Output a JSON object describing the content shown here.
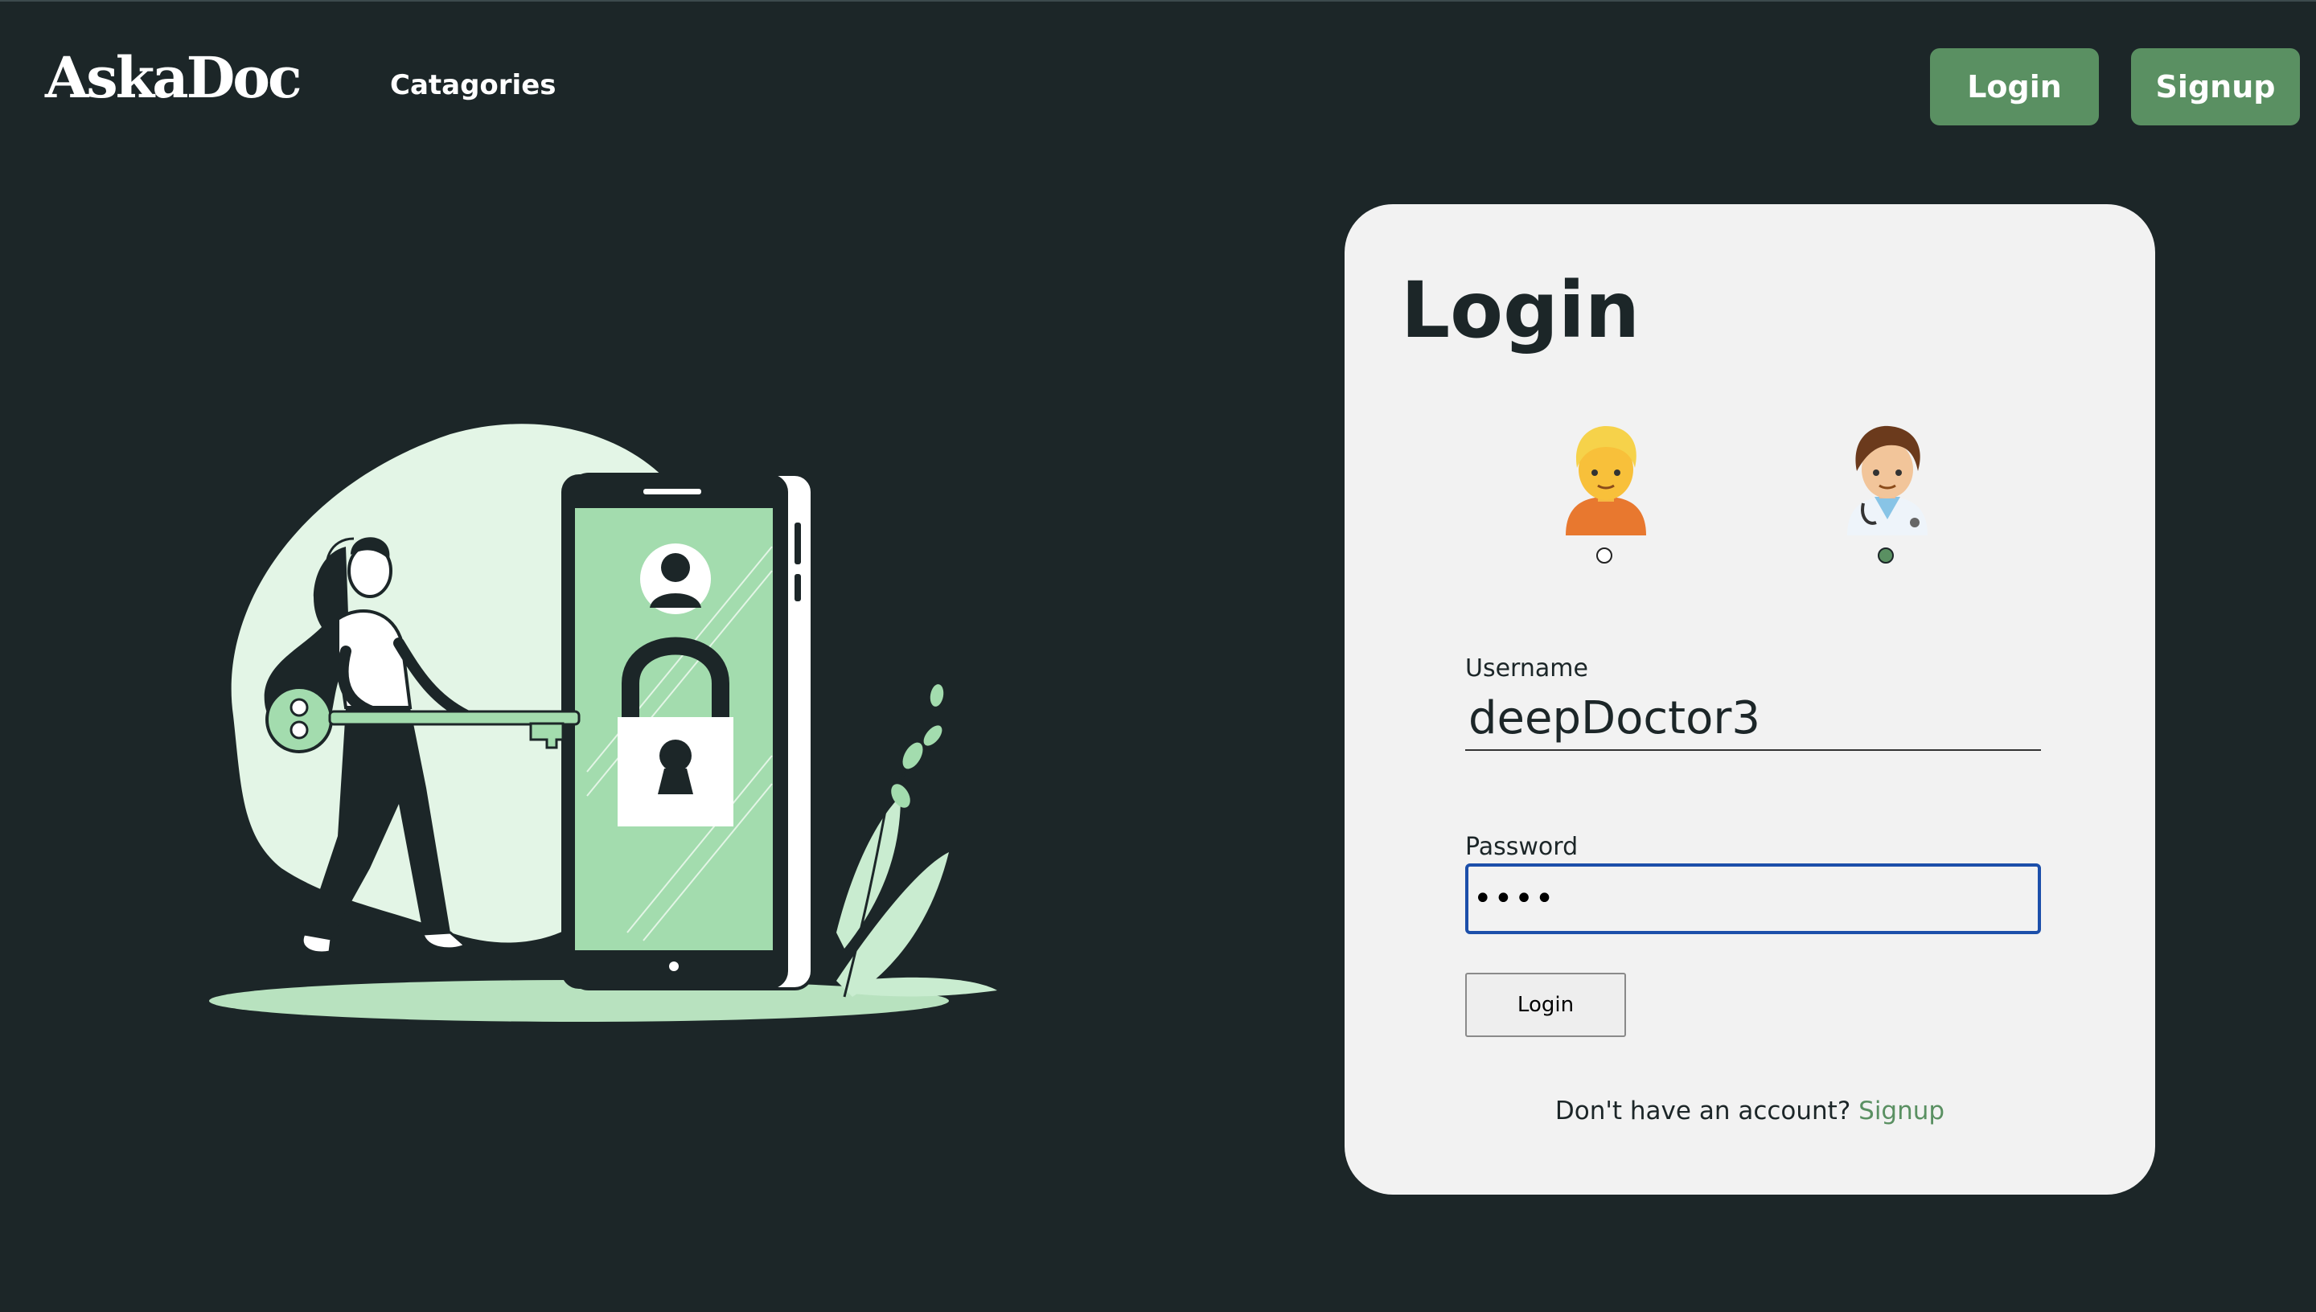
{
  "header": {
    "brand": "AskaDoc",
    "nav_categories": "Catagories",
    "login_button": "Login",
    "signup_button": "Signup"
  },
  "login_card": {
    "title": "Login",
    "roles": [
      {
        "name": "patient",
        "icon": "patient-emoji-icon",
        "selected": false
      },
      {
        "name": "doctor",
        "icon": "health-worker-emoji-icon",
        "selected": true
      }
    ],
    "username_label": "Username",
    "username_value": "deepDoctor3",
    "password_label": "Password",
    "password_value": "abcd",
    "submit_label": "Login",
    "no_account_text": "Don't have an account?",
    "signup_link": "Signup"
  },
  "colors": {
    "background": "#1c2628",
    "accent": "#5a9062",
    "card": "#f2f2f2",
    "focus_border": "#1c4faa",
    "illustration_green": "#a3dcae"
  }
}
